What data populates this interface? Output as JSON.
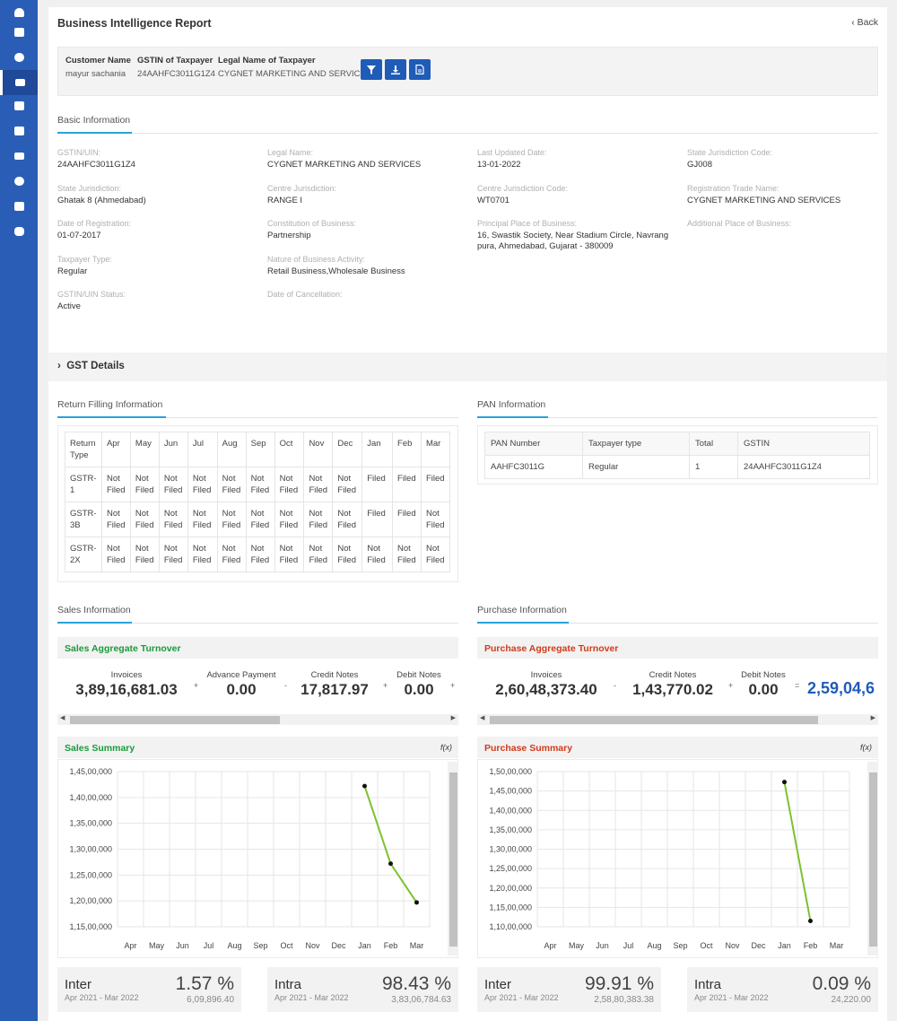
{
  "header": {
    "title": "Business Intelligence Report",
    "back_label": "Back"
  },
  "filter": {
    "customer_name_label": "Customer Name",
    "customer_name": "mayur sachania",
    "gstin_label": "GSTIN of Taxpayer",
    "gstin": "24AAHFC3011G1Z4",
    "legal_name_label": "Legal Name of Taxpayer",
    "legal_name": "CYGNET MARKETING AND SERVICES",
    "buttons": [
      "filter-icon",
      "download-icon",
      "pdf-icon"
    ]
  },
  "basic": {
    "section_title": "Basic Information",
    "items": [
      {
        "k": "GSTIN/UIN:",
        "v": "24AAHFC3011G1Z4"
      },
      {
        "k": "Legal Name:",
        "v": "CYGNET MARKETING AND SERVICES"
      },
      {
        "k": "Last Updated Date:",
        "v": "13-01-2022"
      },
      {
        "k": "State Jurisdiction Code:",
        "v": "GJ008"
      },
      {
        "k": "State Jurisdiction:",
        "v": "Ghatak 8 (Ahmedabad)"
      },
      {
        "k": "Centre Jurisdiction:",
        "v": "RANGE I"
      },
      {
        "k": "Centre Jurisdiction Code:",
        "v": "WT0701"
      },
      {
        "k": "Registration Trade Name:",
        "v": "CYGNET MARKETING AND SERVICES"
      },
      {
        "k": "Date of Registration:",
        "v": "01-07-2017"
      },
      {
        "k": "Constitution of Business:",
        "v": "Partnership"
      },
      {
        "k": "Principal Place of Business:",
        "v": "16, Swastik Society, Near Stadium Circle, Navrang pura, Ahmedabad, Gujarat - 380009"
      },
      {
        "k": "Additional Place of Business:",
        "v": ""
      },
      {
        "k": "Taxpayer Type:",
        "v": "Regular"
      },
      {
        "k": "Nature of Business Activity:",
        "v": "Retail Business,Wholesale Business"
      },
      {
        "k": "GSTIN/UIN Status:",
        "v": "Active"
      },
      {
        "k": "Date of Cancellation:",
        "v": ""
      }
    ]
  },
  "gst_details": {
    "label": "GST Details"
  },
  "return_filing": {
    "section_title": "Return Filling Information",
    "headers": [
      "Return Type",
      "Apr",
      "May",
      "Jun",
      "Jul",
      "Aug",
      "Sep",
      "Oct",
      "Nov",
      "Dec",
      "Jan",
      "Feb",
      "Mar"
    ],
    "rows": [
      [
        "GSTR-1",
        "Not Filed",
        "Not Filed",
        "Not Filed",
        "Not Filed",
        "Not Filed",
        "Not Filed",
        "Not Filed",
        "Not Filed",
        "Not Filed",
        "Filed",
        "Filed",
        "Filed"
      ],
      [
        "GSTR-3B",
        "Not Filed",
        "Not Filed",
        "Not Filed",
        "Not Filed",
        "Not Filed",
        "Not Filed",
        "Not Filed",
        "Not Filed",
        "Not Filed",
        "Filed",
        "Filed",
        "Not Filed"
      ],
      [
        "GSTR-2X",
        "Not Filed",
        "Not Filed",
        "Not Filed",
        "Not Filed",
        "Not Filed",
        "Not Filed",
        "Not Filed",
        "Not Filed",
        "Not Filed",
        "Not Filed",
        "Not Filed",
        "Not Filed"
      ]
    ]
  },
  "pan": {
    "section_title": "PAN Information",
    "headers": [
      "PAN Number",
      "Taxpayer type",
      "Total",
      "GSTIN"
    ],
    "rows": [
      [
        "AAHFC3011G",
        "Regular",
        "1",
        "24AAHFC3011G1Z4"
      ]
    ]
  },
  "sales": {
    "section_title": "Sales Information",
    "aggregate_title": "Sales Aggregate Turnover",
    "aggregate": [
      {
        "label": "Invoices",
        "value": "3,89,16,681.03"
      },
      {
        "label": "Advance Payment",
        "value": "0.00"
      },
      {
        "label": "Credit Notes",
        "value": "17,817.97"
      },
      {
        "label": "Debit Notes",
        "value": "0.00"
      }
    ],
    "ops": [
      "+",
      "-",
      "+",
      "+"
    ],
    "summary_title": "Sales Summary",
    "fx_label": "f(x)",
    "inter": {
      "label": "Inter",
      "range": "Apr 2021 - Mar 2022",
      "percent": "1.57 %",
      "amount": "6,09,896.40"
    },
    "intra": {
      "label": "Intra",
      "range": "Apr 2021 - Mar 2022",
      "percent": "98.43 %",
      "amount": "3,83,06,784.63"
    }
  },
  "purchase": {
    "section_title": "Purchase Information",
    "aggregate_title": "Purchase Aggregate Turnover",
    "aggregate": [
      {
        "label": "Invoices",
        "value": "2,60,48,373.40"
      },
      {
        "label": "Credit Notes",
        "value": "1,43,770.02"
      },
      {
        "label": "Debit Notes",
        "value": "0.00"
      }
    ],
    "ops": [
      "-",
      "+",
      "="
    ],
    "total": "2,59,04,6",
    "summary_title": "Purchase Summary",
    "fx_label": "f(x)",
    "inter": {
      "label": "Inter",
      "range": "Apr 2021 - Mar 2022",
      "percent": "99.91 %",
      "amount": "2,58,80,383.38"
    },
    "intra": {
      "label": "Intra",
      "range": "Apr 2021 - Mar 2022",
      "percent": "0.09 %",
      "amount": "24,220.00"
    }
  },
  "colors": {
    "sidebar": "#2a5db5",
    "accent": "#1f5cb8",
    "sales": "#1a9a3a",
    "purchase": "#d13a1a",
    "line": "#7dc22e",
    "underline": "#29a3d8",
    "total": "#1f5cb8"
  },
  "chart_data": [
    {
      "type": "line",
      "categories": [
        "Apr",
        "May",
        "Jun",
        "Jul",
        "Aug",
        "Sep",
        "Oct",
        "Nov",
        "Dec",
        "Jan",
        "Feb",
        "Mar"
      ],
      "series": [
        {
          "values": [
            null,
            null,
            null,
            null,
            null,
            null,
            null,
            null,
            null,
            14220000,
            12720000,
            11970000
          ]
        }
      ],
      "yticks": [
        "1,15,00,000",
        "1,20,00,000",
        "1,25,00,000",
        "1,30,00,000",
        "1,35,00,000",
        "1,40,00,000",
        "1,45,00,000"
      ],
      "ylim": [
        11500000,
        14500000
      ],
      "grid": true
    },
    {
      "type": "line",
      "categories": [
        "Apr",
        "May",
        "Jun",
        "Jul",
        "Aug",
        "Sep",
        "Oct",
        "Nov",
        "Dec",
        "Jan",
        "Feb",
        "Mar"
      ],
      "series": [
        {
          "values": [
            null,
            null,
            null,
            null,
            null,
            null,
            null,
            null,
            null,
            14730000,
            11150000,
            null
          ]
        }
      ],
      "yticks": [
        "1,10,00,000",
        "1,15,00,000",
        "1,20,00,000",
        "1,25,00,000",
        "1,30,00,000",
        "1,35,00,000",
        "1,40,00,000",
        "1,45,00,000",
        "1,50,00,000"
      ],
      "ylim": [
        11000000,
        15000000
      ],
      "grid": true
    }
  ]
}
